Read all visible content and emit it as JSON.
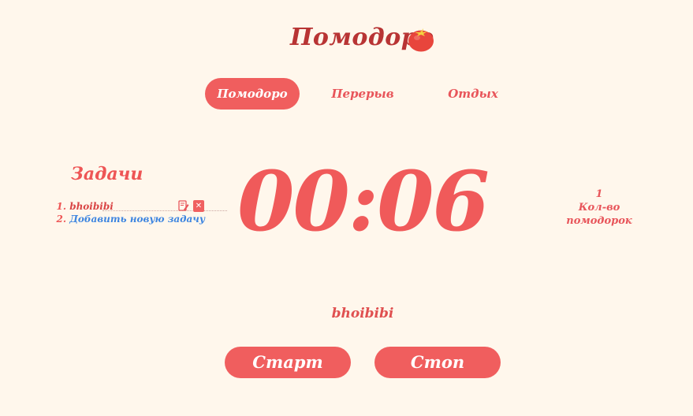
{
  "header": {
    "title": "Помодоро",
    "icon": "tomato-icon"
  },
  "tabs": [
    {
      "label": "Помодоро",
      "active": true
    },
    {
      "label": "Перерыв",
      "active": false
    },
    {
      "label": "Отдых",
      "active": false
    }
  ],
  "tasks": {
    "heading": "Задачи",
    "items": [
      {
        "number": "1.",
        "text": "bhoibibi"
      }
    ],
    "add_number": "2.",
    "add_label": "Добавить новую задачу",
    "edit_icon": "edit-icon",
    "delete_icon": "delete-icon"
  },
  "timer": {
    "display": "00:06"
  },
  "counter": {
    "value": "1",
    "label": "Кол-во помодорок"
  },
  "current_task": "bhoibibi",
  "controls": {
    "start_label": "Старт",
    "stop_label": "Стоп"
  },
  "colors": {
    "background": "#fff7ec",
    "accent": "#f05e5e",
    "title": "#b83434",
    "link": "#3d85e0"
  }
}
